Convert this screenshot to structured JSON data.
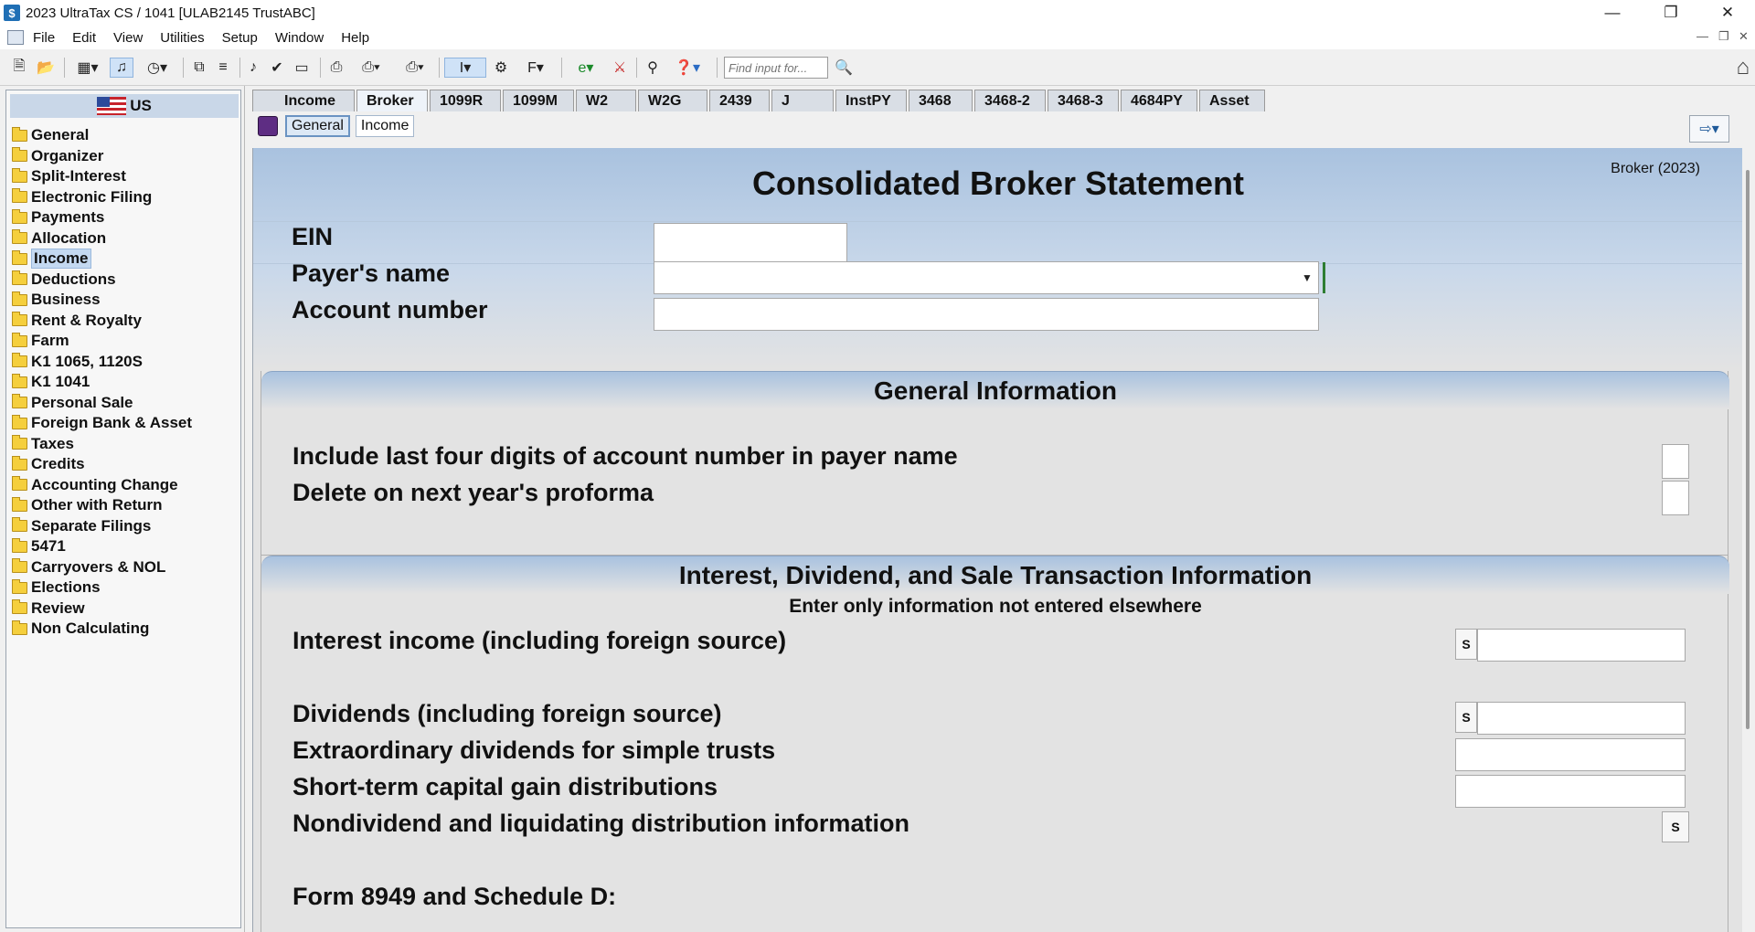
{
  "window": {
    "title": "2023 UltraTax CS  / 1041 [ULAB2145 TrustABC]",
    "app_icon_glyph": "$"
  },
  "menu": [
    "File",
    "Edit",
    "View",
    "Utilities",
    "Setup",
    "Window",
    "Help"
  ],
  "toolbar": {
    "find_placeholder": "Find input for..."
  },
  "sidebar": {
    "header": "US",
    "items": [
      {
        "label": "General",
        "selected": false
      },
      {
        "label": "Organizer",
        "selected": false
      },
      {
        "label": "Split-Interest",
        "selected": false
      },
      {
        "label": "Electronic Filing",
        "selected": false
      },
      {
        "label": "Payments",
        "selected": false
      },
      {
        "label": "Allocation",
        "selected": false
      },
      {
        "label": "Income",
        "selected": true
      },
      {
        "label": "Deductions",
        "selected": false
      },
      {
        "label": "Business",
        "selected": false
      },
      {
        "label": "Rent & Royalty",
        "selected": false
      },
      {
        "label": "Farm",
        "selected": false
      },
      {
        "label": "K1 1065, 1120S",
        "selected": false
      },
      {
        "label": "K1 1041",
        "selected": false
      },
      {
        "label": "Personal Sale",
        "selected": false
      },
      {
        "label": "Foreign Bank & Asset",
        "selected": false
      },
      {
        "label": "Taxes",
        "selected": false
      },
      {
        "label": "Credits",
        "selected": false
      },
      {
        "label": "Accounting Change",
        "selected": false
      },
      {
        "label": "Other with Return",
        "selected": false
      },
      {
        "label": "Separate Filings",
        "selected": false
      },
      {
        "label": "5471",
        "selected": false
      },
      {
        "label": "Carryovers & NOL",
        "selected": false
      },
      {
        "label": "Elections",
        "selected": false
      },
      {
        "label": "Review",
        "selected": false
      },
      {
        "label": "Non Calculating",
        "selected": false
      }
    ]
  },
  "tabs": [
    {
      "label": "Income",
      "active": false
    },
    {
      "label": "Broker",
      "active": true
    },
    {
      "label": "1099R",
      "active": false
    },
    {
      "label": "1099M",
      "active": false
    },
    {
      "label": "W2",
      "active": false
    },
    {
      "label": "W2G",
      "active": false
    },
    {
      "label": "2439",
      "active": false
    },
    {
      "label": "J",
      "active": false
    },
    {
      "label": "InstPY",
      "active": false
    },
    {
      "label": "3468",
      "active": false
    },
    {
      "label": "3468-2",
      "active": false
    },
    {
      "label": "3468-3",
      "active": false
    },
    {
      "label": "4684PY",
      "active": false
    },
    {
      "label": "Asset",
      "active": false
    }
  ],
  "subtabs": [
    {
      "label": "General",
      "active": true
    },
    {
      "label": "Income",
      "active": false
    }
  ],
  "form": {
    "id": "Broker (2023)",
    "title": "Consolidated Broker Statement",
    "ein_label": "EIN",
    "ein_value": "",
    "payer_label": "Payer's name",
    "payer_value": "",
    "account_label": "Account number",
    "account_value": "",
    "general": {
      "title": "General Information",
      "include_label": "Include last four digits of account number in payer name",
      "delete_label": "Delete on next year's proforma"
    },
    "idst": {
      "title": "Interest, Dividend, and Sale Transaction Information",
      "note": "Enter only information not entered elsewhere",
      "interest_label": "Interest income (including foreign source)",
      "dividends_label": "Dividends (including foreign source)",
      "extraordinary_label": "Extraordinary dividends for simple trusts",
      "stcg_label": "Short-term capital gain distributions",
      "nondiv_label": "Nondividend and liquidating distribution information",
      "form8949_label": "Form 8949 and Schedule D:",
      "s_button": "S"
    }
  },
  "colors": {
    "header_blue": "#a9c2df",
    "selected_blue": "#c4d9f1",
    "folder_yellow": "#f5cf3d"
  }
}
